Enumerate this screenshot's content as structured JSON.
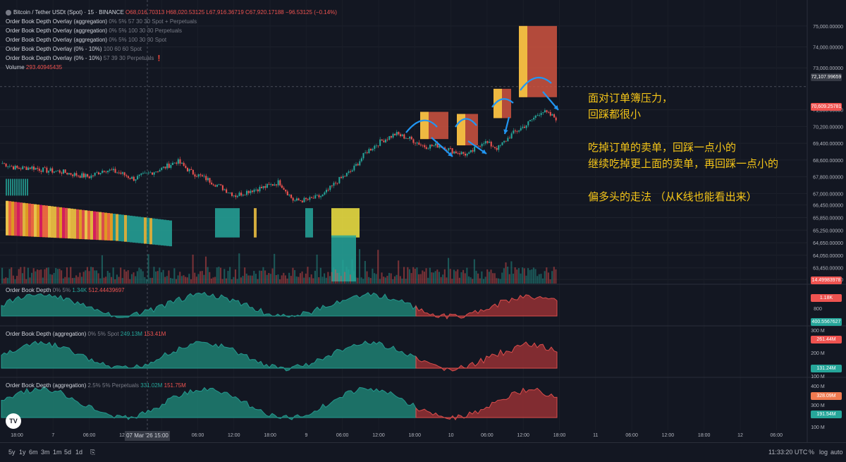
{
  "header": {
    "symbol": "Bitcoin / Tether USDt (Spot) · 15 · BINANCE",
    "ohlc_o": "O68,016.70313",
    "ohlc_h": "H68,020.53125",
    "ohlc_l": "L67,916.36719",
    "ohlc_c": "C67,920.17188",
    "change": "−96.53125 (−0.14%)"
  },
  "indicators": [
    {
      "name": "Order Book Depth Overlay (aggregation)",
      "params": "0% 5% 57 30 30 Spot + Perpetuals"
    },
    {
      "name": "Order Book Depth Overlay (aggregation)",
      "params": "0% 5% 100 30 30 Perpetuals"
    },
    {
      "name": "Order Book Depth Overlay (aggregation)",
      "params": "0% 5% 100 30 30 Spot"
    },
    {
      "name": "Order Book Depth Overlay (0% - 10%)",
      "params": "100 60 60 Spot"
    },
    {
      "name": "Order Book Depth Overlay (0% - 10%)",
      "params": "57 39 30 Perpetuals"
    }
  ],
  "volume": {
    "name": "Volume",
    "value": "293.40945435"
  },
  "pane1": {
    "name": "Order Book Depth",
    "params": "0% 5%",
    "v1": "1.34K",
    "v2": "512.44439697"
  },
  "pane2": {
    "name": "Order Book Depth (aggregation)",
    "params": "0% 5% Spot",
    "v1": "249.13M",
    "v2": "153.41M"
  },
  "pane3": {
    "name": "Order Book Depth (aggregation)",
    "params": "2.5% 5% Perpetuals",
    "v1": "331.02M",
    "v2": "151.75M"
  },
  "price_axis": {
    "ticks": [
      "75,000.00000",
      "74,000.00000",
      "73,000.00000",
      "71,000.00000",
      "70,200.00000",
      "69,400.00000",
      "68,600.00000",
      "67,800.00000",
      "67,000.00000",
      "66,450.00000",
      "65,850.00000",
      "65,250.00000",
      "64,650.00000",
      "64,050.00000",
      "63,450.00000",
      "62,900.00000"
    ],
    "labels": {
      "crosshair": "72,107.99659",
      "last": "70,609.25781",
      "vol": "14.49983978"
    }
  },
  "pane_axes": {
    "p1": {
      "ticks": [
        "800"
      ],
      "labels": [
        "1.18K",
        "400.5567627"
      ]
    },
    "p2": {
      "ticks": [
        "300 M",
        "200 M",
        "100 M"
      ],
      "labels": [
        "261.44M",
        "131.24M"
      ]
    },
    "p3": {
      "ticks": [
        "400 M",
        "300 M",
        "200 M",
        "100 M"
      ],
      "labels": [
        "328.09M",
        "191.54M"
      ]
    }
  },
  "time_axis": [
    "18:00",
    "7",
    "06:00",
    "12:00",
    "8",
    "06:00",
    "12:00",
    "18:00",
    "9",
    "06:00",
    "12:00",
    "18:00",
    "10",
    "06:00",
    "12:00",
    "18:00",
    "11",
    "06:00",
    "12:00",
    "18:00",
    "12",
    "06:00"
  ],
  "crosshair_date": "07 Mar '26  15:00",
  "annotations": [
    "面对订单簿压力，",
    "回踩都很小",
    "吃掉订单的卖单，回踩一点小的",
    "继续吃掉更上面的卖单，再回踩一点小的",
    "偏多头的走法 （从K线也能看出来）"
  ],
  "bottom_bar": {
    "timeframes": [
      "5y",
      "1y",
      "6m",
      "3m",
      "1m",
      "5d",
      "1d"
    ],
    "clock": "11:33:20 UTC",
    "percent": "%",
    "log": "log",
    "auto": "auto"
  },
  "colors": {
    "bg": "#131722",
    "up": "#26a69a",
    "down": "#ef5350",
    "arrow": "#2196f3",
    "annotation": "#f5c518"
  },
  "chart_data": {
    "type": "candlestick",
    "title": "Bitcoin / Tether USDt (Spot) · 15 · BINANCE",
    "ylim": [
      62700,
      75500
    ],
    "x": [
      "18:00",
      "7",
      "06:00",
      "12:00",
      "8",
      "06:00",
      "12:00",
      "18:00",
      "9",
      "06:00",
      "12:00",
      "18:00",
      "10",
      "06:00",
      "12:00"
    ],
    "close_path": [
      68450,
      68200,
      68250,
      68100,
      68050,
      67900,
      67800,
      68150,
      68000,
      67700,
      67950,
      68200,
      68550,
      68000,
      67700,
      67300,
      66900,
      67150,
      67300,
      67550,
      66650,
      66700,
      66900,
      67600,
      68100,
      69000,
      69500,
      69850,
      69600,
      69250,
      69300,
      69000,
      68850,
      69500,
      69150,
      69850,
      70300,
      70950,
      70600
    ]
  }
}
